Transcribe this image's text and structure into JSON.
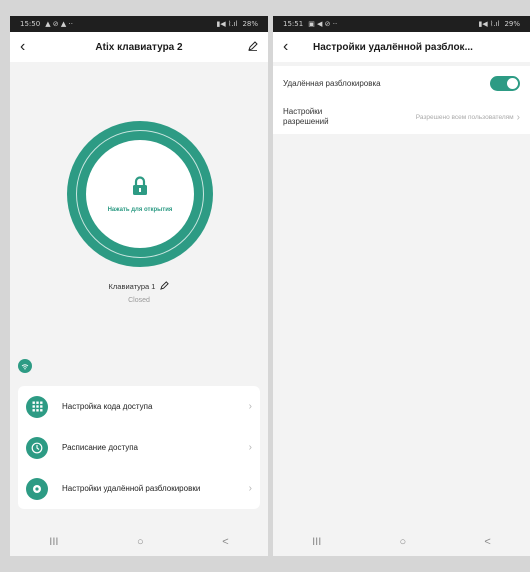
{
  "left": {
    "statusbar": {
      "time": "15:50",
      "indicators": "▲ ⊘ ▲ ·· ",
      "battery": "28%"
    },
    "header": {
      "title": "Atix клавиатура 2"
    },
    "unlock": {
      "label": "Нажать для открытия"
    },
    "keyboard": {
      "name": "Клавиатура 1",
      "status": "Closed"
    },
    "menu": [
      {
        "label": "Настройка кода доступа",
        "icon": "keypad-icon"
      },
      {
        "label": "Расписание доступа",
        "icon": "clock-icon"
      },
      {
        "label": "Настройки удалённой разблокировки",
        "icon": "remote-unlock-icon"
      }
    ],
    "navbar": {
      "recent": "III",
      "home": "○",
      "back": "<"
    }
  },
  "right": {
    "statusbar": {
      "time": "15:51",
      "indicators": "▣ ◀ ⊘ ··",
      "battery": "29%"
    },
    "header": {
      "title": "Настройки удалённой разблок..."
    },
    "remote_unlock": {
      "label": "Удалённая разблокировка",
      "enabled": true
    },
    "permissions": {
      "label": "Настройки разрешений",
      "value": "Разрешено всем пользователям"
    },
    "navbar": {
      "recent": "III",
      "home": "○",
      "back": "<"
    }
  },
  "colors": {
    "accent": "#2d9b84",
    "background": "#f3f3f3"
  }
}
